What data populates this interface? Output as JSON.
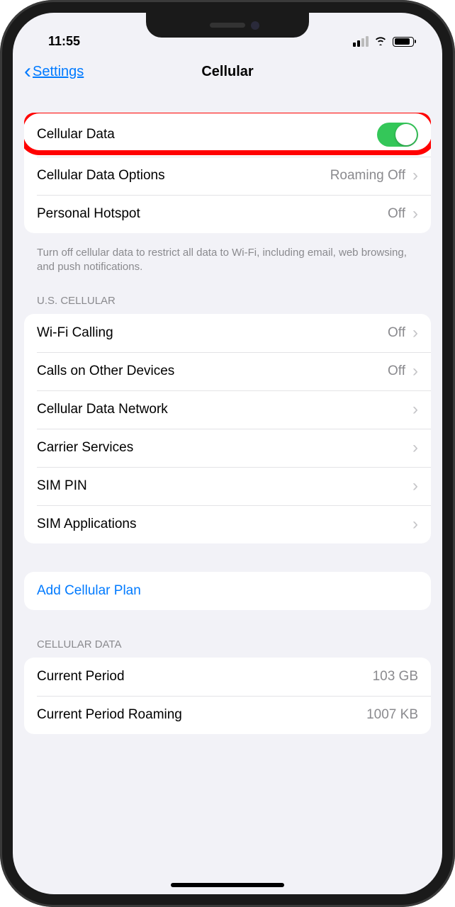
{
  "status": {
    "time": "11:55"
  },
  "nav": {
    "back": "Settings",
    "title": "Cellular"
  },
  "group1": {
    "cellular_data": {
      "label": "Cellular Data",
      "on": true
    },
    "options": {
      "label": "Cellular Data Options",
      "value": "Roaming Off"
    },
    "hotspot": {
      "label": "Personal Hotspot",
      "value": "Off"
    },
    "footer": "Turn off cellular data to restrict all data to Wi-Fi, including email, web browsing, and push notifications."
  },
  "carrier": {
    "header": "U.S. CELLULAR",
    "wifi_calling": {
      "label": "Wi-Fi Calling",
      "value": "Off"
    },
    "other_devices": {
      "label": "Calls on Other Devices",
      "value": "Off"
    },
    "data_network": {
      "label": "Cellular Data Network"
    },
    "carrier_services": {
      "label": "Carrier Services"
    },
    "sim_pin": {
      "label": "SIM PIN"
    },
    "sim_apps": {
      "label": "SIM Applications"
    }
  },
  "add_plan": {
    "label": "Add Cellular Plan"
  },
  "usage": {
    "header": "CELLULAR DATA",
    "current": {
      "label": "Current Period",
      "value": "103 GB"
    },
    "roaming": {
      "label": "Current Period Roaming",
      "value": "1007 KB"
    }
  }
}
